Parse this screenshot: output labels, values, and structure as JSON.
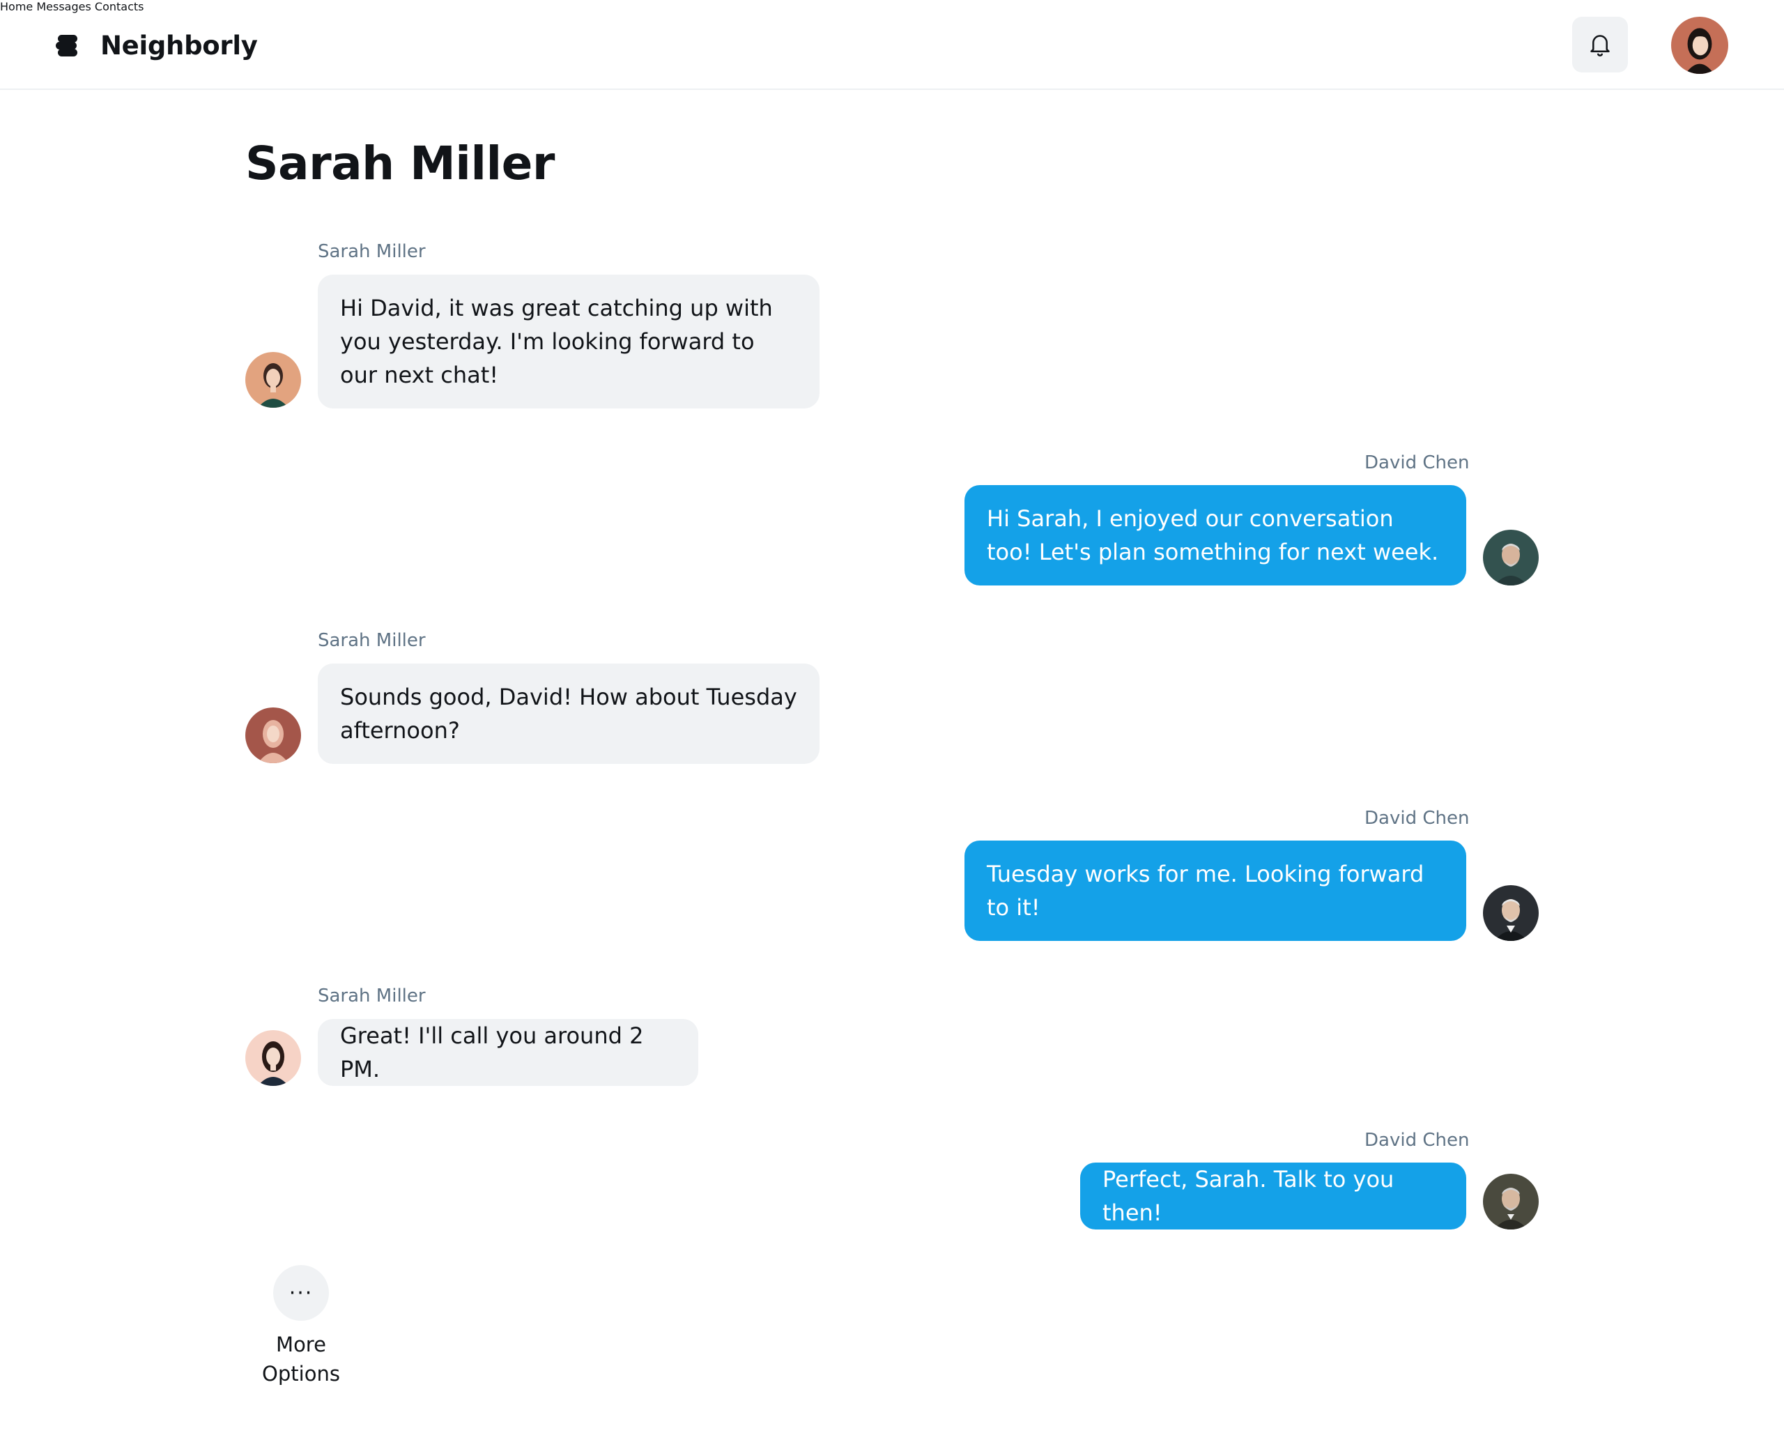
{
  "header": {
    "brand_name": "Neighborly",
    "nav": [
      {
        "label": "Home"
      },
      {
        "label": "Messages"
      },
      {
        "label": "Contacts"
      }
    ],
    "notifications_icon": "bell-icon",
    "profile_avatar_icon": "user-avatar"
  },
  "conversation": {
    "title": "Sarah Miller",
    "messages": [
      {
        "sender": "Sarah Miller",
        "text": "Hi David, it was great catching up with you yesterday. I'm looking forward to our next chat!",
        "direction": "incoming"
      },
      {
        "sender": "David Chen",
        "text": "Hi Sarah, I enjoyed our conversation too! Let's plan something for next week.",
        "direction": "outgoing"
      },
      {
        "sender": "Sarah Miller",
        "text": "Sounds good, David! How about Tuesday afternoon?",
        "direction": "incoming"
      },
      {
        "sender": "David Chen",
        "text": "Tuesday works for me. Looking forward to it!",
        "direction": "outgoing"
      },
      {
        "sender": "Sarah Miller",
        "text": "Great! I'll call you around 2 PM.",
        "direction": "incoming"
      },
      {
        "sender": "David Chen",
        "text": "Perfect, Sarah. Talk to you then!",
        "direction": "outgoing"
      }
    ]
  },
  "more_options": {
    "icon": "ellipsis-icon",
    "glyph": "···",
    "label": "More Options"
  },
  "colors": {
    "outgoing_bubble": "#14a1e8",
    "incoming_bubble": "#f0f2f4",
    "sender_label": "#5f7385"
  }
}
